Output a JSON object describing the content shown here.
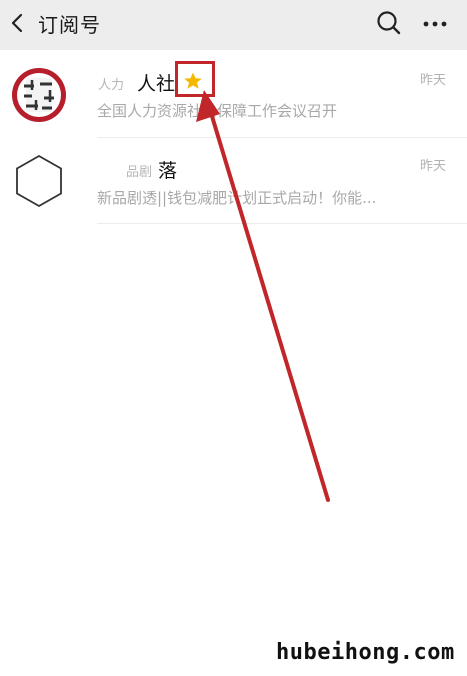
{
  "header": {
    "title": "订阅号",
    "back_icon": "chevron-left-icon",
    "search_icon": "search-icon",
    "more_icon": "more-horizontal-icon"
  },
  "subscriptions": [
    {
      "name_faded": "人力",
      "name": "人社",
      "starred": true,
      "time": "昨天",
      "snippet": "全国人力资源社会保障工作会议召开"
    },
    {
      "name_faded": "品剧",
      "name": "落",
      "starred": false,
      "time": "昨天",
      "snippet": "新品剧透||钱包减肥计划正式启动！你能..."
    }
  ],
  "annotation": {
    "highlight_color": "#c0262a",
    "star_color": "#f5b800"
  },
  "watermark": "hubeihong.com"
}
